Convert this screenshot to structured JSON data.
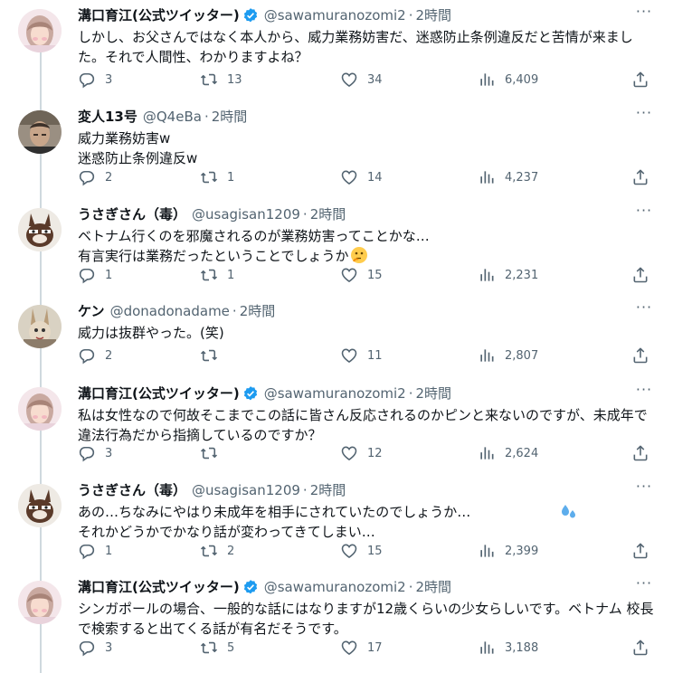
{
  "tweets": [
    {
      "name": "溝口育江(公式ツイッター)",
      "handle": "@sawamuranozomi2",
      "time": "2時間",
      "verified": true,
      "text": "しかし、お父さんではなく本人から、威力業務妨害だ、迷惑防止条例違反だと苦情が来ました。それで人間性、わかりますよね？",
      "replies": "3",
      "retweets": "13",
      "likes": "34",
      "views": "6,409"
    },
    {
      "name": "変人13号",
      "handle": "@Q4eBa",
      "time": "2時間",
      "verified": false,
      "text": "威力業務妨害w\n迷惑防止条例違反w",
      "replies": "2",
      "retweets": "1",
      "likes": "14",
      "views": "4,237"
    },
    {
      "name": "うさぎさん（毒）",
      "handle": "@usagisan1209",
      "time": "2時間",
      "verified": false,
      "text": "ベトナム行くのを邪魔されるのが業務妨害ってことかな…\n有言実行は業務だったということでしょうか",
      "emoji": "thinking-face-icon",
      "replies": "1",
      "retweets": "1",
      "likes": "15",
      "views": "2,231"
    },
    {
      "name": "ケン",
      "handle": "@donadonadame",
      "time": "2時間",
      "verified": false,
      "text": "威力は抜群やった。(笑)",
      "replies": "2",
      "retweets": "",
      "likes": "11",
      "views": "2,807"
    },
    {
      "name": "溝口育江(公式ツイッター)",
      "handle": "@sawamuranozomi2",
      "time": "2時間",
      "verified": true,
      "text": "私は女性なので何故そこまでこの話に皆さん反応されるのかピンと来ないのですが、未成年で違法行為だから指摘しているのですか？",
      "replies": "3",
      "retweets": "",
      "likes": "12",
      "views": "2,624"
    },
    {
      "name": "うさぎさん（毒）",
      "handle": "@usagisan1209",
      "time": "2時間",
      "verified": false,
      "text": "あの…ちなみにやはり未成年を相手にされていたのでしょうか…\nそれかどうかでかなり話が変わってきてしまい…",
      "emoji": "sweat-droplets-icon",
      "replies": "1",
      "retweets": "2",
      "likes": "15",
      "views": "2,399"
    },
    {
      "name": "溝口育江(公式ツイッター)",
      "handle": "@sawamuranozomi2",
      "time": "2時間",
      "verified": true,
      "text": "シンガポールの場合、一般的な話にはなりますが12歳くらいの少女らしいです。ベトナム 校長で検索すると出てくる話が有名だそうです。",
      "replies": "3",
      "retweets": "5",
      "likes": "17",
      "views": "3,188"
    }
  ],
  "ui": {
    "dot": "·",
    "more": "···"
  }
}
